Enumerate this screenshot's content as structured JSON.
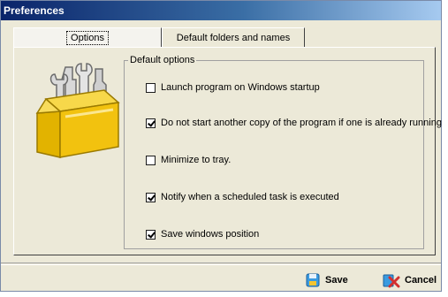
{
  "window": {
    "title": "Preferences"
  },
  "tabs": [
    {
      "label": "Options",
      "active": true
    },
    {
      "label": "Default folders and names",
      "active": false
    }
  ],
  "options_group": {
    "label": "Default options",
    "items": [
      {
        "label": "Launch program on Windows startup",
        "checked": false
      },
      {
        "label": "Do not start another copy of the program if one is already running",
        "checked": true
      },
      {
        "label": "Minimize to tray.",
        "checked": false
      },
      {
        "label": "Notify when a scheduled task is executed",
        "checked": true
      },
      {
        "label": "Save windows position",
        "checked": true
      }
    ]
  },
  "buttons": {
    "save_label": "Save",
    "cancel_label": "Cancel"
  },
  "icons": {
    "illustration": "toolbox-icon",
    "save": "save-icon",
    "cancel": "cancel-icon"
  },
  "colors": {
    "toolbox_yellow": "#f2c20f",
    "titlebar": "#0a246a",
    "save_icon": "#3a9be0",
    "cancel_icon": "#d23030"
  }
}
